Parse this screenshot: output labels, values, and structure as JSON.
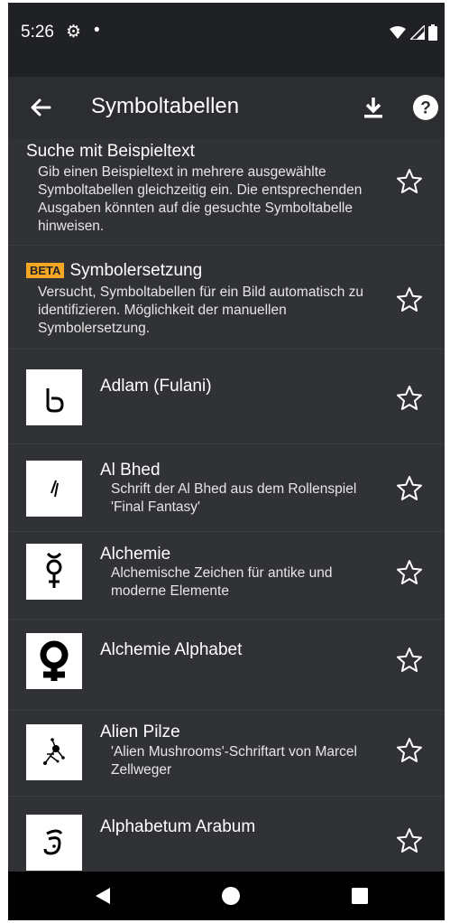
{
  "status": {
    "time": "5:26"
  },
  "appbar": {
    "title": "Symboltabellen"
  },
  "special_items": [
    {
      "title": "Suche mit Beispieltext",
      "desc": "Gib einen Beispieltext in mehrere ausgewählte Symboltabellen gleichzeitig ein. Die entsprechenden Ausgaben könnten auf die gesuchte Symboltabelle hinweisen."
    },
    {
      "badge": "BETA",
      "title": "Symbolersetzung",
      "desc": "Versucht, Symboltabellen für ein Bild automatisch zu identifizieren. Möglichkeit der manuellen Symbolersetzung."
    }
  ],
  "symbol_tables": [
    {
      "title": "Adlam (Fulani)",
      "desc": "",
      "icon": "adlam-glyph"
    },
    {
      "title": "Al Bhed",
      "desc": "Schrift der Al Bhed aus dem Rollenspiel 'Final Fantasy'",
      "icon": "albhed-glyph"
    },
    {
      "title": "Alchemie",
      "desc": "Alchemische Zeichen für antike und moderne Elemente",
      "icon": "mercury-glyph"
    },
    {
      "title": "Alchemie Alphabet",
      "desc": "",
      "icon": "alchemy-alphabet-glyph"
    },
    {
      "title": "Alien Pilze",
      "desc": "'Alien Mushrooms'-Schriftart von Marcel Zellweger",
      "icon": "alien-mushroom-glyph"
    },
    {
      "title": "Alphabetum Arabum",
      "desc": "",
      "icon": "arabum-glyph"
    }
  ],
  "colors": {
    "background": "#303236",
    "statusbar": "#202124",
    "appbar": "#2b2d31",
    "beta_badge": "#f5a623",
    "text": "#ffffff"
  }
}
